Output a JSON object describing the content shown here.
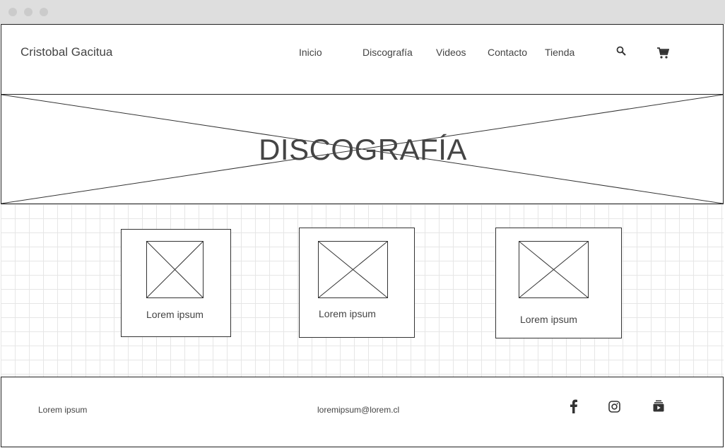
{
  "header": {
    "brand": "Cristobal Gacitua",
    "nav": [
      {
        "label": "Inicio"
      },
      {
        "label": "Discografía"
      },
      {
        "label": "Videos"
      },
      {
        "label": "Contacto"
      },
      {
        "label": "Tienda"
      }
    ],
    "icons": [
      "search-icon",
      "cart-icon"
    ]
  },
  "hero": {
    "title": "DISCOGRAFÍA",
    "image": "placeholder-image"
  },
  "albums": [
    {
      "label": "Lorem ipsum",
      "image": "placeholder-image"
    },
    {
      "label": "Lorem ipsum",
      "image": "placeholder-image"
    },
    {
      "label": "Lorem ipsum",
      "image": "placeholder-image"
    }
  ],
  "footer": {
    "left_text": "Lorem ipsum",
    "email": "loremipsum@lorem.cl",
    "social_icons": [
      "facebook-icon",
      "instagram-icon",
      "youtube-icon"
    ]
  },
  "colors": {
    "stroke": "#222222",
    "text": "#444444",
    "titlebar": "#dedede",
    "grid": "#e6e6e6"
  }
}
